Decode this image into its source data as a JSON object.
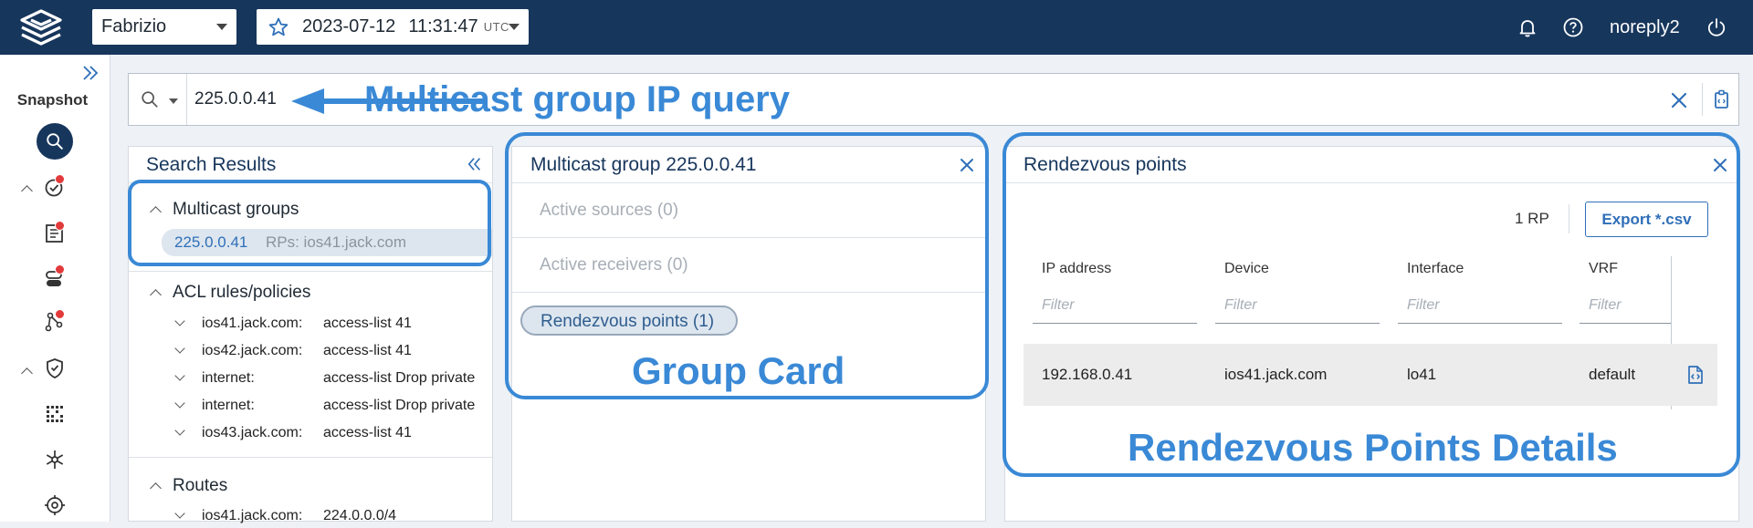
{
  "topbar": {
    "snapshot_owner": "Fabrizio",
    "snapshot_date": "2023-07-12",
    "snapshot_time": "11:31:47",
    "timezone": "UTC",
    "username": "noreply2",
    "bg_color": "#17365c"
  },
  "rail": {
    "label": "Snapshot"
  },
  "search": {
    "query": "225.0.0.41"
  },
  "annotations": {
    "query": "Multicast group IP query",
    "group_card": "Group Card",
    "rp_details": "Rendezvous Points Details"
  },
  "results": {
    "title": "Search Results",
    "multicast_heading": "Multicast groups",
    "multicast_item_ip": "225.0.0.41",
    "multicast_item_rps": "RPs: ios41.jack.com",
    "acl_heading": "ACL rules/policies",
    "acl_rows": [
      {
        "device": "ios41.jack.com:",
        "value": "access-list 41"
      },
      {
        "device": "ios42.jack.com:",
        "value": "access-list 41"
      },
      {
        "device": "internet:",
        "value": "access-list Drop private"
      },
      {
        "device": "internet:",
        "value": "access-list Drop private"
      },
      {
        "device": "ios43.jack.com:",
        "value": "access-list 41"
      }
    ],
    "routes_heading": "Routes",
    "routes_rows": [
      {
        "device": "ios41.jack.com:",
        "value": "224.0.0.0/4"
      }
    ]
  },
  "group_card": {
    "title": "Multicast group 225.0.0.41",
    "active_sources": "Active sources (0)",
    "active_receivers": "Active receivers (0)",
    "rendezvous_points": "Rendezvous points (1)"
  },
  "rp_panel": {
    "title": "Rendezvous points",
    "count": "1 RP",
    "export_label": "Export *.csv",
    "columns": [
      "IP address",
      "Device",
      "Interface",
      "VRF"
    ],
    "filter_placeholder": "Filter",
    "rows": [
      {
        "ip": "192.168.0.41",
        "device": "ios41.jack.com",
        "interface": "lo41",
        "vrf": "default"
      }
    ]
  },
  "colors": {
    "accent": "#3a89d6",
    "badge": "#e23a3a",
    "navy": "#17365c"
  }
}
